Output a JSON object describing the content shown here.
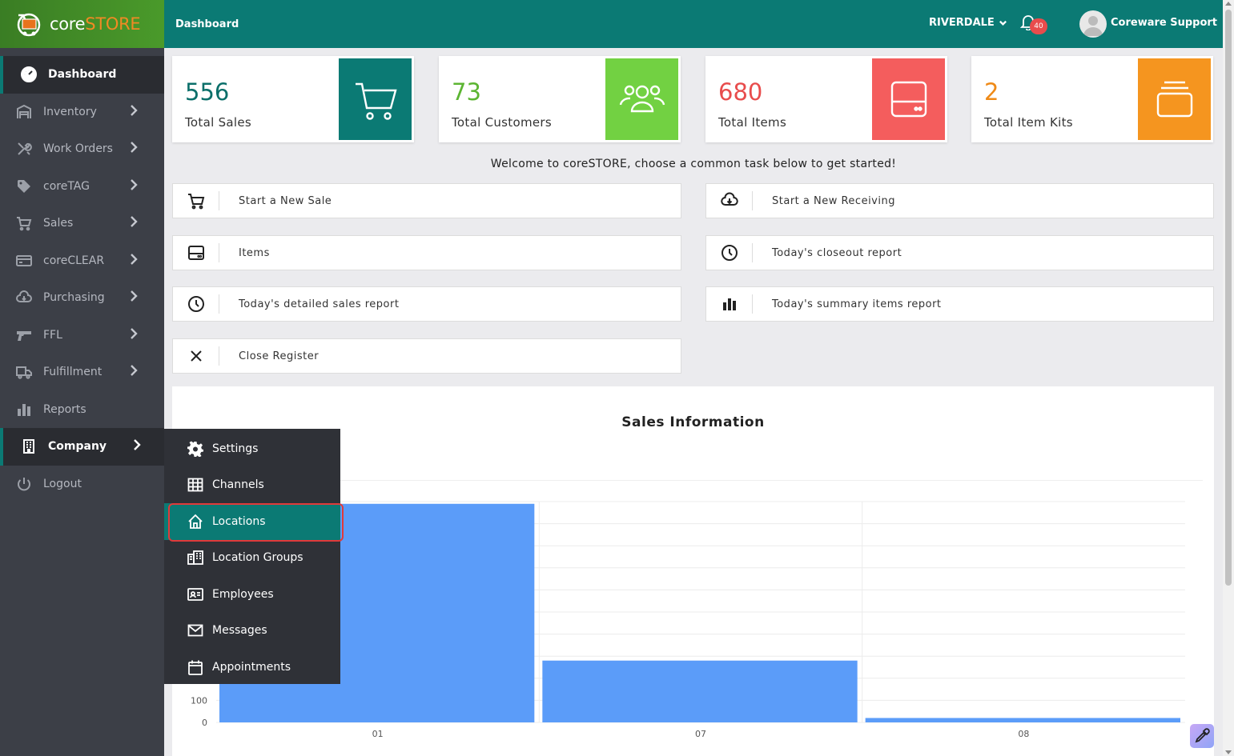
{
  "brand": {
    "name_prefix": "core",
    "name_suffix": "STORE"
  },
  "topbar": {
    "breadcrumb": "Dashboard",
    "location": "RIVERDALE",
    "notification_count": "40",
    "user_name": "Coreware Support"
  },
  "sidebar": {
    "items": [
      {
        "label": "Dashboard",
        "icon": "dashboard-icon"
      },
      {
        "label": "Inventory",
        "icon": "inventory-icon"
      },
      {
        "label": "Work Orders",
        "icon": "tools-icon"
      },
      {
        "label": "coreTAG",
        "icon": "tag-icon"
      },
      {
        "label": "Sales",
        "icon": "cart-icon"
      },
      {
        "label": "coreCLEAR",
        "icon": "card-icon"
      },
      {
        "label": "Purchasing",
        "icon": "cloud-download-icon"
      },
      {
        "label": "FFL",
        "icon": "gun-icon"
      },
      {
        "label": "Fulfillment",
        "icon": "truck-icon"
      },
      {
        "label": "Reports",
        "icon": "bar-chart-icon"
      },
      {
        "label": "Company",
        "icon": "building-icon"
      },
      {
        "label": "Logout",
        "icon": "power-icon"
      }
    ]
  },
  "stats": [
    {
      "value": "556",
      "label": "Total Sales",
      "color": "#0b7a74",
      "value_color": "#0b6f6a"
    },
    {
      "value": "73",
      "label": "Total Customers",
      "color": "#72d142",
      "value_color": "#5cb532"
    },
    {
      "value": "680",
      "label": "Total Items",
      "color": "#f45d5d",
      "value_color": "#e84c4c"
    },
    {
      "value": "2",
      "label": "Total Item Kits",
      "color": "#f5951f",
      "value_color": "#ef8a17"
    }
  ],
  "welcome": "Welcome to coreSTORE, choose a common task below to get started!",
  "tasks": [
    {
      "label": "Start a New Sale",
      "icon": "cart-icon"
    },
    {
      "label": "Start a New Receiving",
      "icon": "cloud-download-icon"
    },
    {
      "label": "Items",
      "icon": "hdd-icon"
    },
    {
      "label": "Today's closeout report",
      "icon": "clock-icon"
    },
    {
      "label": "Today's detailed sales report",
      "icon": "clock-icon"
    },
    {
      "label": "Today's summary items report",
      "icon": "bar-chart-icon"
    },
    {
      "label": "Close Register",
      "icon": "close-icon"
    }
  ],
  "company_menu": {
    "items": [
      {
        "label": "Settings",
        "icon": "gear-icon"
      },
      {
        "label": "Channels",
        "icon": "grid-icon"
      },
      {
        "label": "Locations",
        "icon": "home-icon"
      },
      {
        "label": "Location Groups",
        "icon": "buildings-icon"
      },
      {
        "label": "Employees",
        "icon": "id-card-icon"
      },
      {
        "label": "Messages",
        "icon": "envelope-icon"
      },
      {
        "label": "Appointments",
        "icon": "calendar-icon"
      }
    ],
    "selected": "Locations"
  },
  "chart_data": {
    "type": "bar",
    "title": "Sales Information",
    "categories": [
      "01",
      "07",
      "08"
    ],
    "values": [
      990,
      280,
      20
    ],
    "visible_yticks": [
      0,
      100
    ],
    "ylim": [
      0,
      1000
    ],
    "color": "#5b9cf9",
    "grid": true
  }
}
